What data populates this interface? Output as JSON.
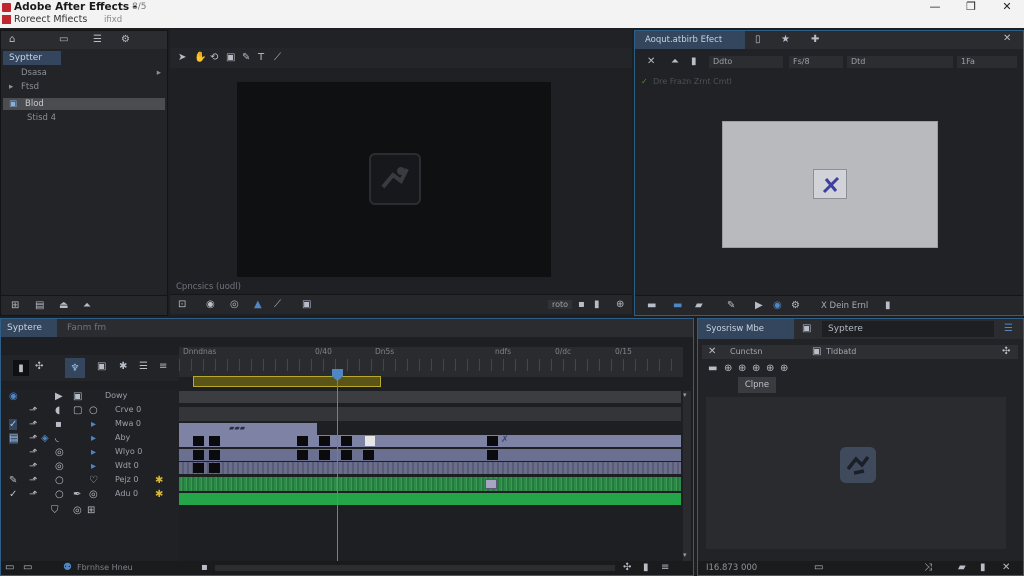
{
  "window": {
    "title": "Adobe After Effects -",
    "title_suffix": "8/5",
    "subtitle": "Roreect Mfiects",
    "subtitle_suffix": "ifixd",
    "minimize": "—",
    "maximize": "❐",
    "close": "✕"
  },
  "project": {
    "tab_label": "Syptter",
    "items": [
      {
        "label": "Dsasa",
        "arrow": "▸"
      },
      {
        "label": "Ftsd",
        "arrow": ""
      },
      {
        "label": "Blod",
        "arrow": ""
      },
      {
        "label": "Stisd 4",
        "arrow": ""
      }
    ]
  },
  "viewer": {
    "status_label": "Cpncsics (uodl)",
    "footer_label": "roto"
  },
  "effects": {
    "tab_label": "Aoqut.atbirb Efect",
    "fields": [
      "Ddto",
      "Fs/8",
      "Dtd",
      "1Fa"
    ],
    "subheading": "Dre Frazn Zrnt Cmtl",
    "footer_label": "X  Dein Ernl"
  },
  "timeline": {
    "tab_active": "Syptere",
    "tab_inactive": "Fanm fm",
    "top_row_label": "Dowy",
    "ruler_labels": [
      "Dnndnas",
      "0/40",
      "Dn5s",
      "ndfs",
      "0/dc",
      "0/15"
    ],
    "layers": [
      {
        "name": "Crve 0"
      },
      {
        "name": "Mwa 0"
      },
      {
        "name": "Aby"
      },
      {
        "name": "Wlyo 0"
      },
      {
        "name": "Wdt 0"
      },
      {
        "name": "Pejz 0"
      },
      {
        "name": "Adu 0"
      }
    ],
    "footer_label": "Fbrnhse Hneu"
  },
  "library": {
    "tab_label": "Syosrisw Mbe",
    "search_value": "Syptere",
    "col1": "Cunctsn",
    "col2": "Tldbatd",
    "row_label": "Clpne",
    "footer_label": "I16.873 000"
  },
  "colors": {
    "accent": "#2e6da4",
    "playhead": "#4f86c6",
    "work_area": "#b9a92a",
    "video_track": "#7e83a6",
    "audio_track": "#2c8c47"
  }
}
